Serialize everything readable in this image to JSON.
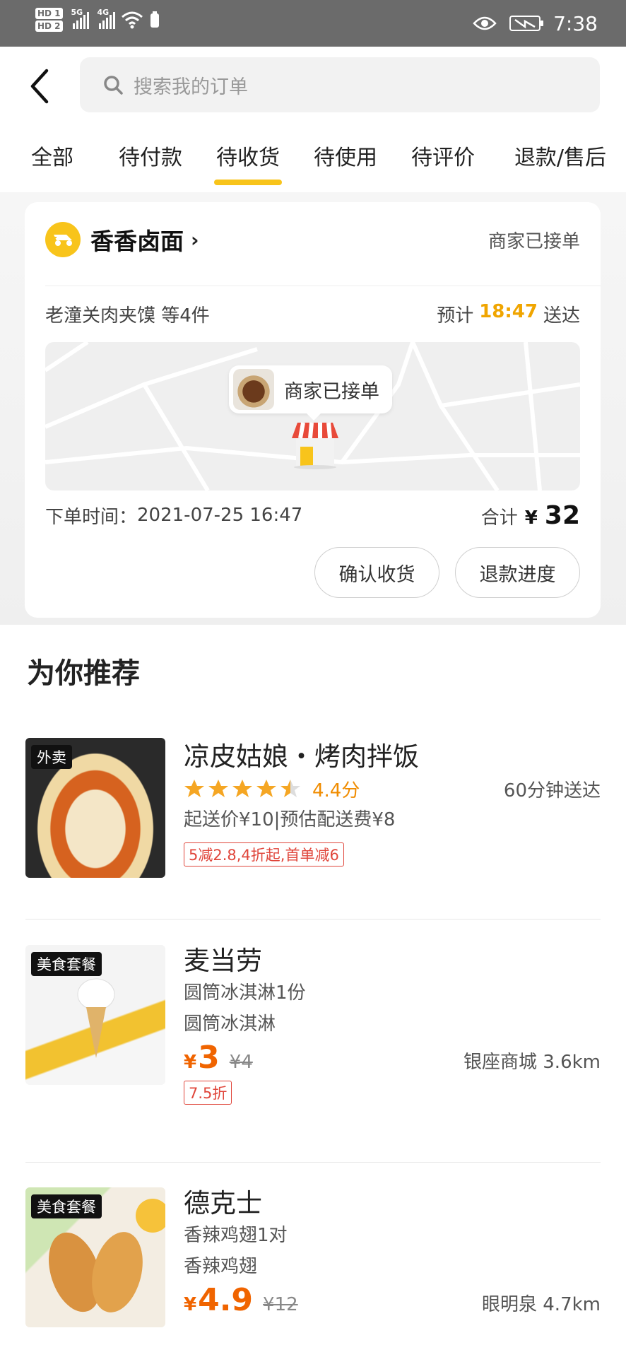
{
  "status_bar": {
    "hd1": "HD 1",
    "hd2": "HD 2",
    "net1": "5G",
    "net2": "4G",
    "time": "7:38"
  },
  "search": {
    "placeholder": "搜索我的订单"
  },
  "tabs": [
    {
      "label": "全部"
    },
    {
      "label": "待付款"
    },
    {
      "label": "待收货"
    },
    {
      "label": "待使用"
    },
    {
      "label": "待评价"
    },
    {
      "label": "退款/售后"
    }
  ],
  "active_tab": "待收货",
  "accent_color": "#f8c41b",
  "order": {
    "shop_name": "香香卤面",
    "status": "商家已接单",
    "items": "老潼关肉夹馍 等4件",
    "eta_prefix": "预计",
    "eta_time": "18:47",
    "eta_suffix": "送达",
    "map_bubble": "商家已接单",
    "order_time_label": "下单时间：",
    "order_time": "2021-07-25 16:47",
    "total_label": "合计",
    "currency": "¥",
    "total": "32",
    "confirm_button": "确认收货",
    "refund_button": "退款进度"
  },
  "recommend": {
    "title": "为你推荐",
    "items": [
      {
        "tag": "外卖",
        "name": "凉皮姑娘・烤肉拌饭",
        "rating_value": 4.4,
        "rating_text": "4.4分",
        "delivery": "60分钟送达",
        "fees": "起送价¥10|预估配送费¥8",
        "promo": "5减2.8,4折起,首单减6"
      },
      {
        "tag": "美食套餐",
        "name": "麦当劳",
        "line1": "圆筒冰淇淋1份",
        "line2": "圆筒冰淇淋",
        "currency": "¥",
        "price": "3",
        "original": "¥4",
        "distance": "银座商城  3.6km",
        "promo": "7.5折"
      },
      {
        "tag": "美食套餐",
        "name": "德克士",
        "line1": "香辣鸡翅1对",
        "line2": "香辣鸡翅",
        "currency": "¥",
        "price": "4.9",
        "original": "¥12",
        "distance": "眼明泉  4.7km"
      }
    ]
  }
}
